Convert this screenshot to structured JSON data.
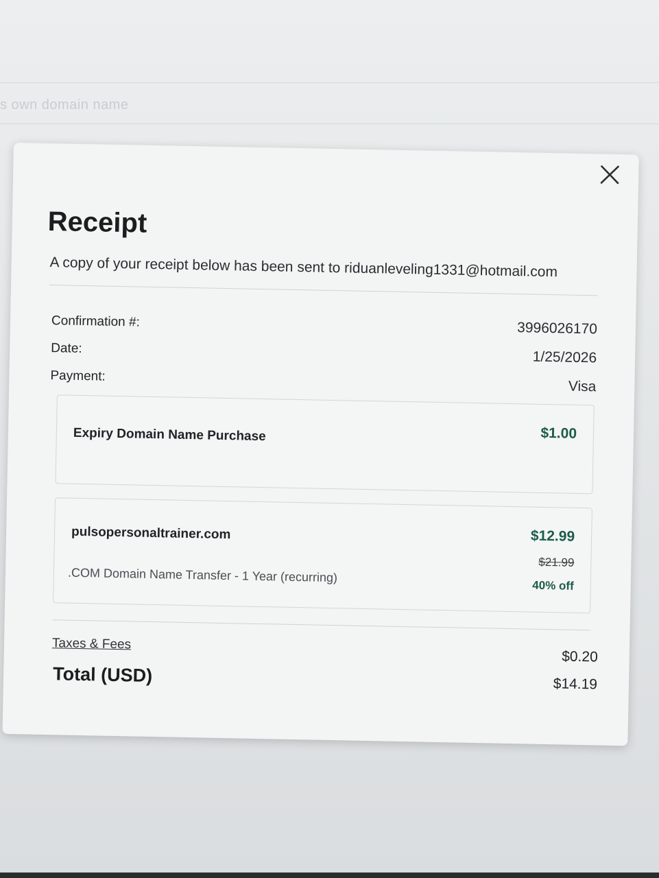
{
  "background": {
    "hint_text": "s own domain name"
  },
  "receipt": {
    "title": "Receipt",
    "subtitle": "A copy of your receipt below has been sent to riduanleveling1331@hotmail.com",
    "info": [
      {
        "label": "Confirmation #:",
        "value": "3996026170"
      },
      {
        "label": "Date:",
        "value": "1/25/2026"
      },
      {
        "label": "Payment:",
        "value": "Visa"
      }
    ],
    "items": [
      {
        "name": "Expiry Domain Name Purchase",
        "price": "$1.00"
      },
      {
        "name": "pulsopersonaltrainer.com",
        "description": ".COM Domain Name Transfer - 1 Year (recurring)",
        "price": "$12.99",
        "original_price": "$21.99",
        "discount": "40% off"
      }
    ],
    "taxes_label": "Taxes & Fees",
    "taxes_value": "$0.20",
    "total_label": "Total (USD)",
    "total_value": "$14.19"
  },
  "colors": {
    "price_accent": "#1c5c4a",
    "modal_background": "#f3f4f4"
  },
  "icons": {
    "close": "close-icon"
  }
}
